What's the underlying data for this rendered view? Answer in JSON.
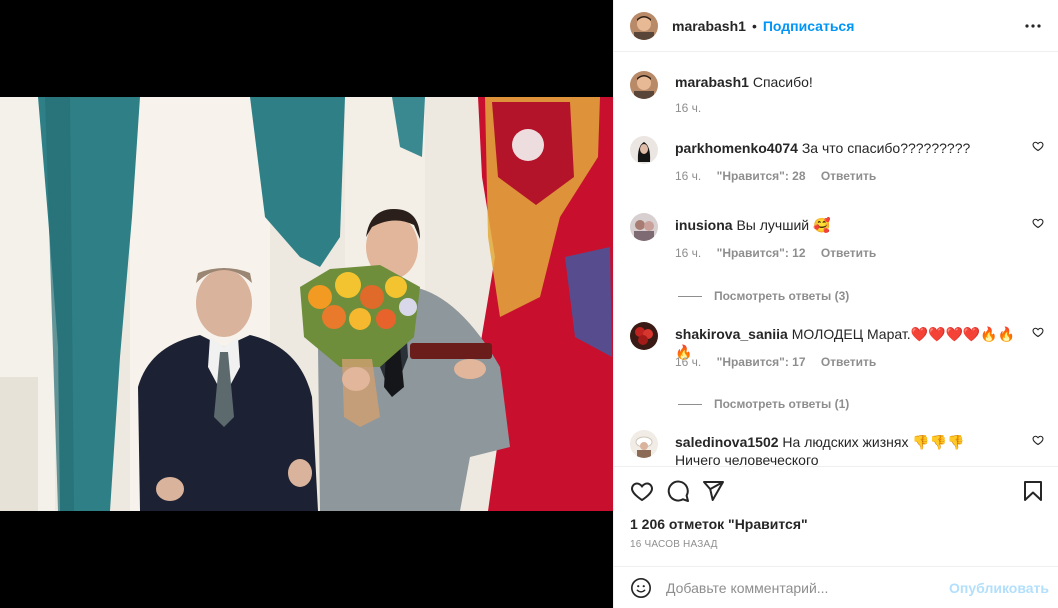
{
  "post": {
    "username": "marabash1",
    "follow_label": "Подписаться",
    "separator": "•",
    "caption": "Спасибо!",
    "caption_time": "16 ч."
  },
  "comments": [
    {
      "username": "parkhomenko4074",
      "text": "За что спасибо?????????",
      "time": "16 ч.",
      "likes": "\"Нравится\": 28",
      "reply": "Ответить"
    },
    {
      "username": "inusiona",
      "text": "Вы лучший 🥰",
      "time": "16 ч.",
      "likes": "\"Нравится\": 12",
      "reply": "Ответить",
      "view_replies": "Посмотреть ответы (3)"
    },
    {
      "username": "shakirova_saniia",
      "text": "МОЛОДЕЦ Марат.❤️❤️❤️❤️🔥🔥🔥",
      "time": "16 ч.",
      "likes": "\"Нравится\": 17",
      "reply": "Ответить",
      "view_replies": "Посмотреть ответы (1)"
    },
    {
      "username": "saledinova1502",
      "text": "На людских жизнях 👎👎👎",
      "text2": "Ничего человеческого"
    }
  ],
  "stats": {
    "likes": "1 206 отметок \"Нравится\"",
    "timestamp": "16 ЧАСОВ НАЗАД"
  },
  "composer": {
    "placeholder": "Добавьте комментарий...",
    "post_label": "Опубликовать"
  },
  "icons": {
    "like": "heart-icon",
    "comment": "comment-icon",
    "share": "paper-plane-icon",
    "save": "bookmark-icon",
    "more": "more-horizontal-icon",
    "emoji": "smiley-icon"
  },
  "colors": {
    "accent": "#0095f6",
    "post_disabled": "#b2dffc",
    "muted": "#8e8e8e"
  }
}
